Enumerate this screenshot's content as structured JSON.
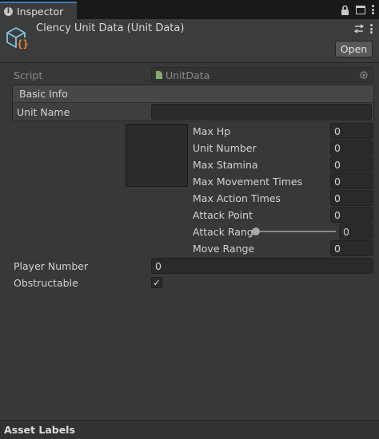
{
  "tab": {
    "label": "Inspector"
  },
  "header": {
    "title": "Clency Unit Data (Unit Data)",
    "open_label": "Open"
  },
  "script": {
    "label": "Script",
    "value": "UnitData"
  },
  "basic_info": {
    "header": "Basic Info",
    "unit_name_label": "Unit Name",
    "unit_name_value": ""
  },
  "stats": [
    {
      "label": "Max Hp",
      "value": "0"
    },
    {
      "label": "Unit Number",
      "value": "0"
    },
    {
      "label": "Max Stamina",
      "value": "0"
    },
    {
      "label": "Max Movement Times",
      "value": "0"
    },
    {
      "label": "Max Action Times",
      "value": "0"
    },
    {
      "label": "Attack Point",
      "value": "0"
    },
    {
      "label": "Attack Rang",
      "value": "0",
      "slider_fraction": 0
    },
    {
      "label": "Move Range",
      "value": "0"
    }
  ],
  "player_number": {
    "label": "Player Number",
    "value": "0"
  },
  "obstructable": {
    "label": "Obstructable",
    "checked": true,
    "mark": "✓"
  },
  "footer": {
    "label": "Asset Labels"
  },
  "icons": {
    "tab": "info-icon",
    "lock": "lock-icon",
    "maximize": "maximize-icon",
    "menu": "kebab-menu-icon",
    "asset": "scriptable-object-icon",
    "preset": "preset-icon",
    "script_file": "script-file-icon",
    "object_picker": "object-picker-icon"
  },
  "colors": {
    "background": "#383838",
    "accent": "#3a79bb",
    "field": "#2a2a2a"
  }
}
